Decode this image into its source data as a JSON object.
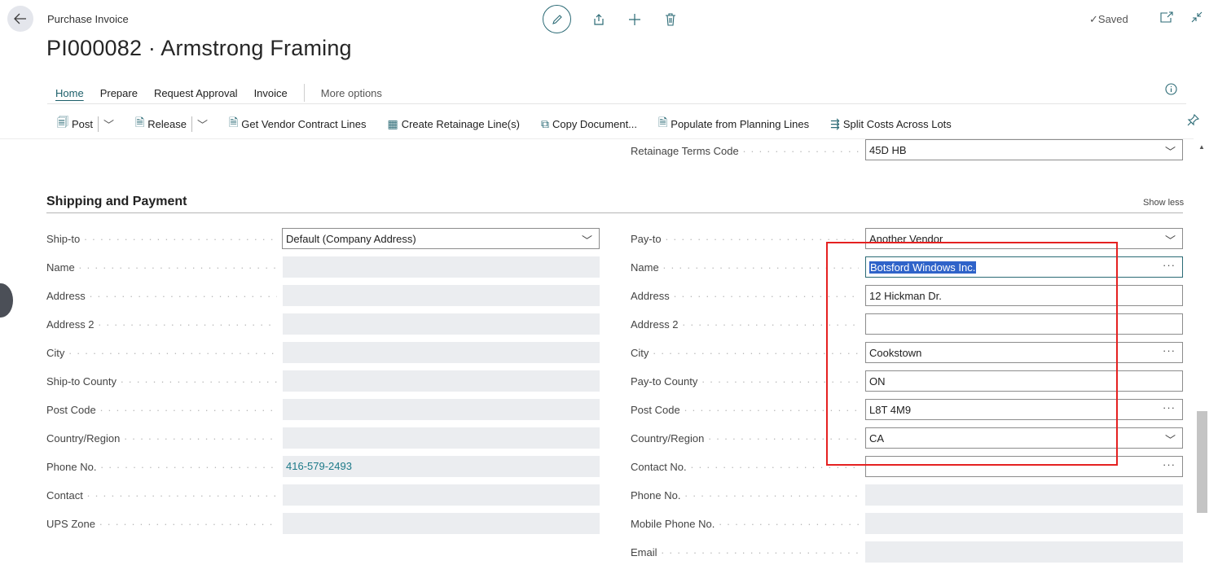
{
  "header": {
    "breadcrumb": "Purchase Invoice",
    "title": "PI000082 · Armstrong Framing",
    "saved": "✓Saved"
  },
  "nav": {
    "tabs": [
      "Home",
      "Prepare",
      "Request Approval",
      "Invoice"
    ],
    "more": "More options"
  },
  "toolbar": {
    "post": "Post",
    "release": "Release",
    "get_vendor": "Get Vendor Contract Lines",
    "create_retainage": "Create Retainage Line(s)",
    "copy_document": "Copy Document...",
    "populate": "Populate from Planning Lines",
    "split_costs": "Split Costs Across Lots"
  },
  "retainage": {
    "label": "Retainage Terms Code",
    "value": "45D HB"
  },
  "section": {
    "title": "Shipping and Payment",
    "show_less": "Show less"
  },
  "ship": {
    "ship_to_label": "Ship-to",
    "ship_to_value": "Default (Company Address)",
    "name_label": "Name",
    "address_label": "Address",
    "address2_label": "Address 2",
    "city_label": "City",
    "county_label": "Ship-to County",
    "post_code_label": "Post Code",
    "country_label": "Country/Region",
    "phone_label": "Phone No.",
    "phone_value": "416-579-2493",
    "contact_label": "Contact",
    "ups_label": "UPS Zone"
  },
  "pay": {
    "pay_to_label": "Pay-to",
    "pay_to_value": "Another Vendor",
    "name_label": "Name",
    "name_value": "Botsford Windows Inc.",
    "address_label": "Address",
    "address_value": "12 Hickman Dr.",
    "address2_label": "Address 2",
    "address2_value": "",
    "city_label": "City",
    "city_value": "Cookstown",
    "county_label": "Pay-to County",
    "county_value": "ON",
    "post_code_label": "Post Code",
    "post_code_value": "L8T 4M9",
    "country_label": "Country/Region",
    "country_value": "CA",
    "contact_label": "Contact No.",
    "contact_value": "",
    "phone_label": "Phone No.",
    "mobile_label": "Mobile Phone No.",
    "email_label": "Email"
  },
  "icons": {
    "back": "arrow-left-icon",
    "edit": "pencil-icon",
    "share": "share-icon",
    "add": "plus-icon",
    "delete": "trash-icon",
    "open_new": "open-new-window-icon",
    "collapse": "collapse-icon",
    "info": "info-icon",
    "pin": "pin-icon"
  },
  "colors": {
    "accent": "#2b6a75",
    "highlight_border": "#e52121",
    "selection": "#2f63c9"
  }
}
